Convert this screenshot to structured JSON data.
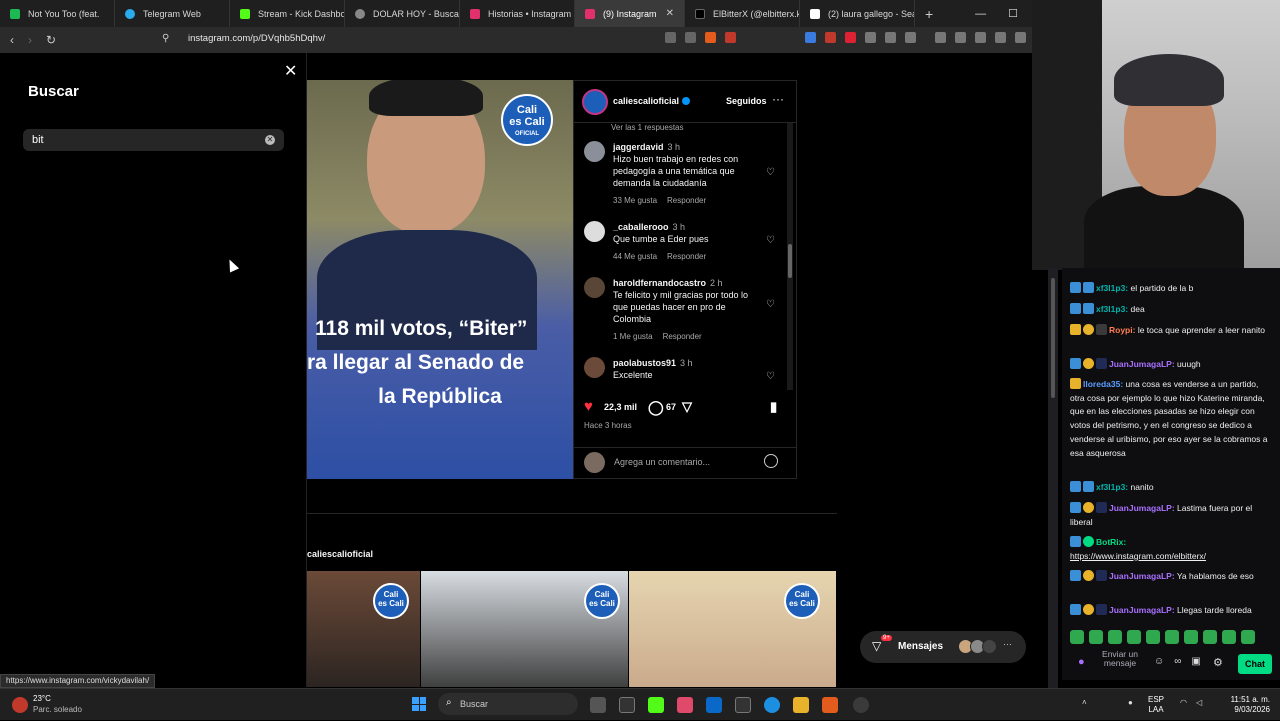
{
  "browser": {
    "tabs": [
      {
        "label": "Not You Too (feat.",
        "color": "#1db954"
      },
      {
        "label": "Telegram Web",
        "color": "#2aabee"
      },
      {
        "label": "Stream - Kick Dashboa",
        "color": "#53fc18"
      },
      {
        "label": "DOLAR HOY - Buscar c",
        "color": "#888888"
      },
      {
        "label": "Historias • Instagram",
        "color": "#e1306c"
      },
      {
        "label": "(9) Instagram",
        "color": "#e1306c",
        "active": true
      },
      {
        "label": "ElBitterX (@elbitterx.k",
        "color": "#000000"
      },
      {
        "label": "(2) laura gallego - Sear",
        "color": "#ffffff"
      }
    ],
    "url": "instagram.com/p/DVqhb5hDqhv/"
  },
  "search": {
    "title": "Buscar",
    "query": "bit"
  },
  "post": {
    "headline_lines": [
      "118 mil votos, “Biter”",
      "ra llegar al Senado de",
      "la República"
    ],
    "badge": {
      "line1": "Cali",
      "line2": "es Cali",
      "line3": "OFICIAL"
    },
    "author": "caliescalioficial",
    "follow_label": "Seguidos",
    "more_label": "···",
    "view_replies": "Ver las 1 respuestas",
    "comments": [
      {
        "user": "jaggerdavid",
        "time": "3 h",
        "text": "Hizo buen trabajo en redes con pedagogía a una temática que demanda la ciudadanía",
        "likes": "33 Me gusta",
        "reply": "Responder"
      },
      {
        "user": "_caballerooo",
        "time": "3 h",
        "text": "Que tumbe a Eder pues",
        "likes": "44 Me gusta",
        "reply": "Responder"
      },
      {
        "user": "haroldfernandocastro",
        "time": "2 h",
        "text": "Te felicito y mil gracias por todo lo que puedas hacer en pro de Colombia",
        "likes": "1 Me gusta",
        "reply": "Responder"
      },
      {
        "user": "paolabustos91",
        "time": "3 h",
        "text": "Excelente",
        "likes": "",
        "reply": ""
      }
    ],
    "like_count": "22,3 mil",
    "comment_count": "67",
    "posted": "Hace 3 horas",
    "add_comment_placeholder": "Agrega un comentario...",
    "more_from": "caliescalioficial"
  },
  "messages": {
    "label": "Mensajes",
    "badge": "9+"
  },
  "status_url": "https://www.instagram.com/vickydavilah/",
  "chat": {
    "messages": [
      {
        "user": "xf3l1p3:",
        "text": " el partido de la b",
        "color": "#00b5ad"
      },
      {
        "user": "xf3l1p3:",
        "text": " dea",
        "color": "#00b5ad"
      },
      {
        "user": "Roypi:",
        "text": " le toca que aprender a leer nanito",
        "color": "#ff7f50"
      },
      {
        "user": "JuanJumagaLP:",
        "text": " uuugh",
        "color": "#a970ff"
      },
      {
        "user": "lloreda35:",
        "text": " una cosa es venderse a un partido, otra cosa por ejemplo lo que hizo Katerine miranda, que en las elecciones pasadas se hizo elegir con votos del petrismo, y en el congreso se dedico a venderse al uribismo, por eso ayer se la cobramos a esa asquerosa",
        "color": "#5c9dff"
      },
      {
        "user": "xf3l1p3:",
        "text": " nanito",
        "color": "#00b5ad"
      },
      {
        "user": "JuanJumagaLP:",
        "text": " Lastima fuera por el liberal",
        "color": "#a970ff"
      },
      {
        "user": "BotRix:",
        "text": " https://www.instagram.com/elbitterx/",
        "color": "#00db84"
      },
      {
        "user": "JuanJumagaLP:",
        "text": " Ya hablamos de eso",
        "color": "#a970ff"
      },
      {
        "user": "JuanJumagaLP:",
        "text": " Llegas tarde lloreda",
        "color": "#a970ff"
      }
    ],
    "input_placeholder": "Enviar un mensaje",
    "send_label": "Chat"
  },
  "taskbar": {
    "temp": "23°C",
    "weather": "Parc. soleado",
    "search_label": "Buscar",
    "lang_line1": "ESP",
    "lang_line2": "LAA",
    "time": "11:51 a. m.",
    "date": "9/03/2026"
  },
  "icons": {
    "like": "heart-filled-icon",
    "comment": "speech-bubble-icon",
    "share": "paper-plane-icon",
    "save": "bookmark-icon",
    "close": "close-icon",
    "clear": "clear-circle-icon"
  }
}
